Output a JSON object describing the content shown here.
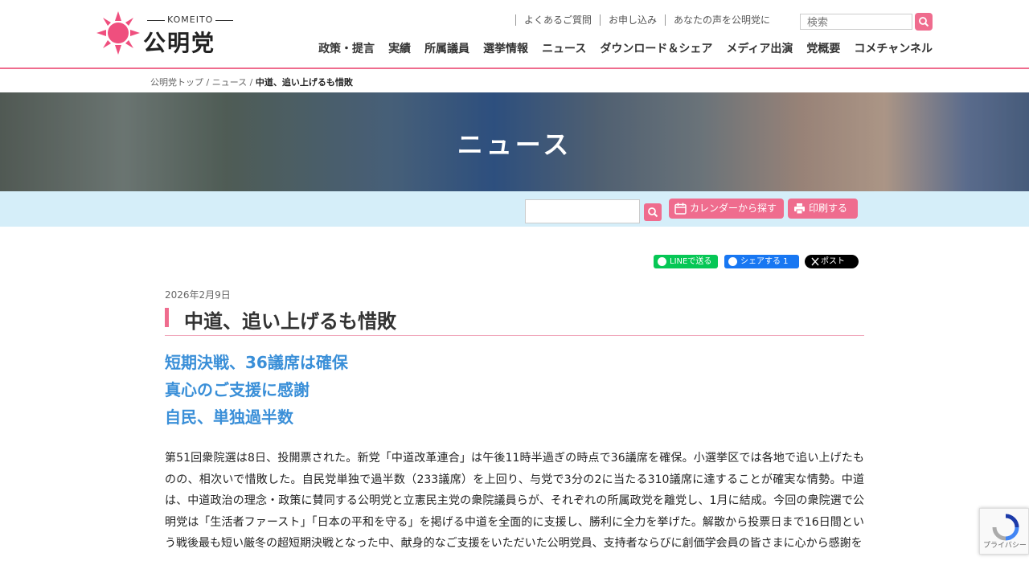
{
  "header": {
    "logo_top": "KOMEITO",
    "logo_name": "公明党",
    "util_links": [
      "よくあるご質問",
      "お申し込み",
      "あなたの声を公明党に"
    ],
    "search_placeholder": "検索",
    "nav": [
      "政策・提言",
      "実績",
      "所属議員",
      "選挙情報",
      "ニュース",
      "ダウンロード＆シェア",
      "メディア出演",
      "党概要",
      "コメチャンネル"
    ]
  },
  "breadcrumb": {
    "home": "公明党トップ",
    "section": "ニュース",
    "current": "中道、追い上げるも惜敗",
    "sep": " / "
  },
  "hero": {
    "title": "ニュース"
  },
  "toolbar": {
    "calendar_label": "カレンダーから探す",
    "print_label": "印刷する"
  },
  "share": {
    "line": "LINEで送る",
    "facebook": "シェアする 1",
    "x": "ポスト"
  },
  "article": {
    "date": "2026年2月9日",
    "title": "中道、追い上げるも惜敗",
    "subtitles": [
      "短期決戦、36議席は確保",
      "真心のご支援に感謝",
      "自民、単独過半数"
    ],
    "body": "第51回衆院選は8日、投開票された。新党「中道改革連合」は午後11時半過ぎの時点で36議席を確保。小選挙区では各地で追い上げたものの、相次いで惜敗した。自民党単独で過半数（233議席）を上回り、与党で3分の2に当たる310議席に達することが確実な情勢。中道は、中道政治の理念・政策に賛同する公明党と立憲民主党の衆院議員らが、それぞれの所属政党を離党し、1月に結成。今回の衆院選で公明党は「生活者ファースト」「日本の平和を守る」を掲げる中道を全面的に支援し、勝利に全力を挙げた。解散から投票日まで16日間という戦後最も短い厳冬の超短期決戦となった中、献身的なご支援をいただいた公明党員、支持者ならびに創価学会員の皆さまに心から感謝を"
  },
  "recaptcha": {
    "text": "プライバシー・利用規約"
  },
  "colors": {
    "accent": "#ef6c8e",
    "subtitle": "#3a8fd8",
    "toolbar_bg": "#d5eef9",
    "line": "#06c755",
    "facebook": "#1877f2",
    "x": "#000000"
  }
}
